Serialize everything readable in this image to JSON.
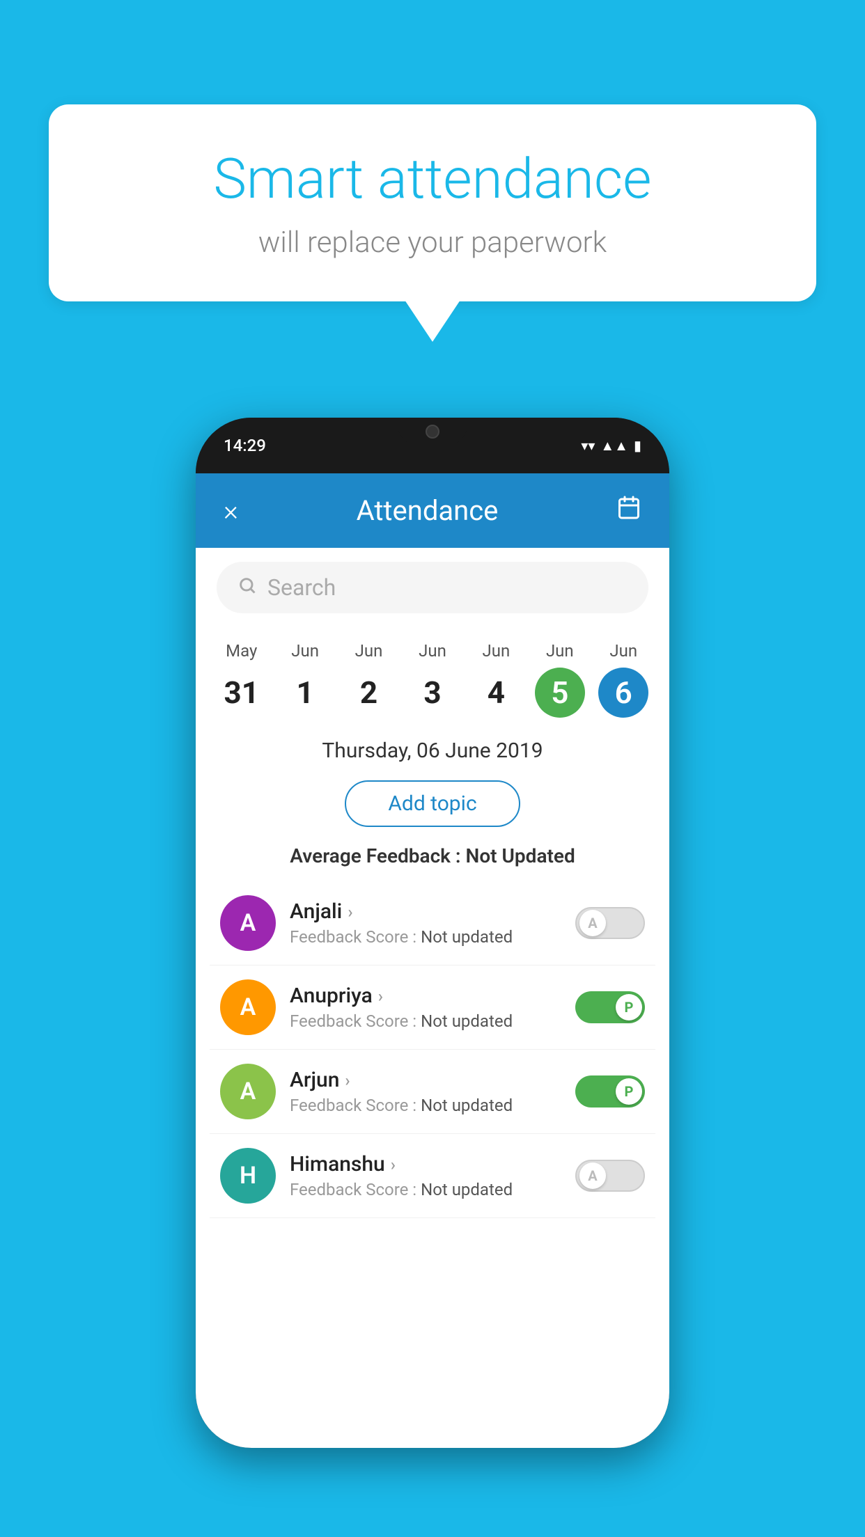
{
  "background_color": "#1ab8e8",
  "speech_bubble": {
    "title": "Smart attendance",
    "subtitle": "will replace your paperwork"
  },
  "phone": {
    "status_bar": {
      "time": "14:29"
    },
    "header": {
      "title": "Attendance",
      "close_label": "×"
    },
    "search": {
      "placeholder": "Search"
    },
    "date_picker": {
      "dates": [
        {
          "month": "May",
          "day": "31",
          "highlight": "none"
        },
        {
          "month": "Jun",
          "day": "1",
          "highlight": "none"
        },
        {
          "month": "Jun",
          "day": "2",
          "highlight": "none"
        },
        {
          "month": "Jun",
          "day": "3",
          "highlight": "none"
        },
        {
          "month": "Jun",
          "day": "4",
          "highlight": "none"
        },
        {
          "month": "Jun",
          "day": "5",
          "highlight": "green"
        },
        {
          "month": "Jun",
          "day": "6",
          "highlight": "blue"
        }
      ]
    },
    "selected_date_label": "Thursday, 06 June 2019",
    "add_topic_label": "Add topic",
    "avg_feedback_label": "Average Feedback : ",
    "avg_feedback_value": "Not Updated",
    "students": [
      {
        "name": "Anjali",
        "avatar_letter": "A",
        "avatar_color": "purple",
        "feedback_label": "Feedback Score : ",
        "feedback_value": "Not updated",
        "toggle_state": "off",
        "toggle_letter": "A"
      },
      {
        "name": "Anupriya",
        "avatar_letter": "A",
        "avatar_color": "orange",
        "feedback_label": "Feedback Score : ",
        "feedback_value": "Not updated",
        "toggle_state": "on",
        "toggle_letter": "P"
      },
      {
        "name": "Arjun",
        "avatar_letter": "A",
        "avatar_color": "light-green",
        "feedback_label": "Feedback Score : ",
        "feedback_value": "Not updated",
        "toggle_state": "on",
        "toggle_letter": "P"
      },
      {
        "name": "Himanshu",
        "avatar_letter": "H",
        "avatar_color": "teal",
        "feedback_label": "Feedback Score : ",
        "feedback_value": "Not updated",
        "toggle_state": "off",
        "toggle_letter": "A"
      }
    ]
  }
}
